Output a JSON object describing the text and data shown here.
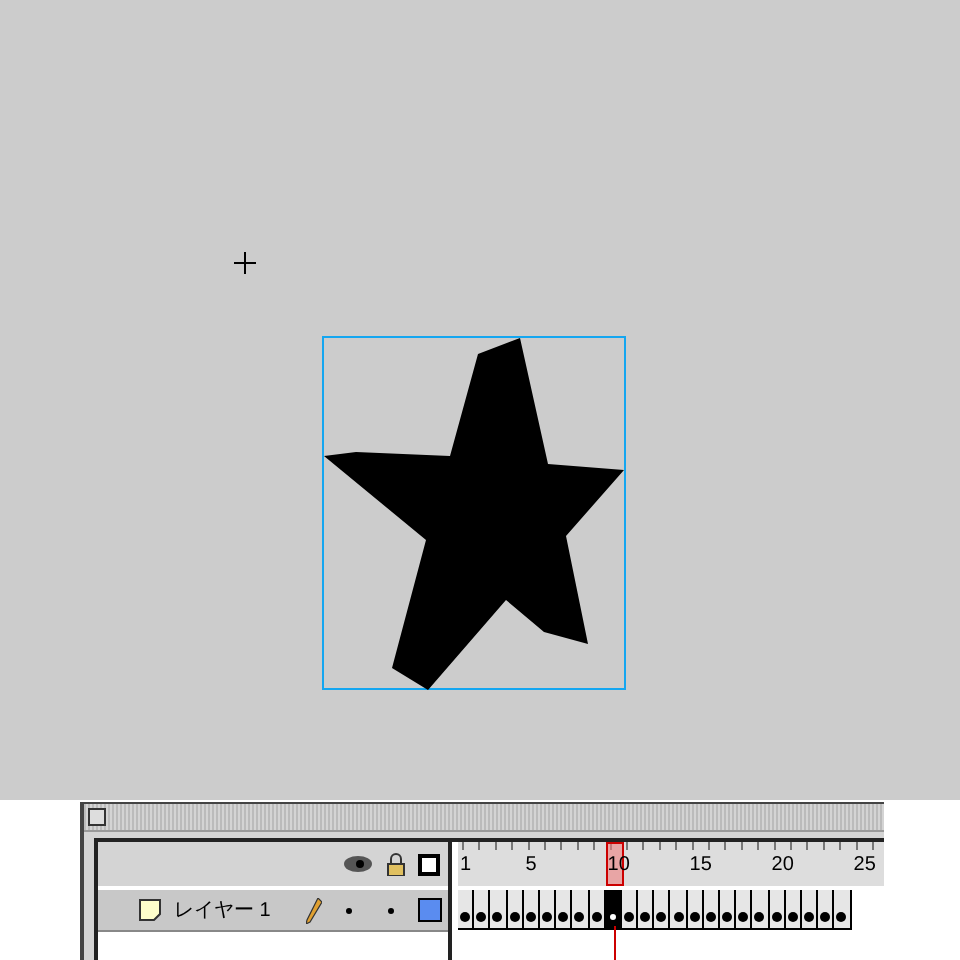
{
  "timeline": {
    "ruler": [
      {
        "label": "1"
      },
      {
        "label": "5"
      },
      {
        "label": "10"
      },
      {
        "label": "15"
      },
      {
        "label": "20"
      },
      {
        "label": "25"
      }
    ],
    "layers": [
      {
        "name": "レイヤー 1",
        "selected": true,
        "color": "#5a8cf0",
        "frames": [
          {
            "kind": "keyframe",
            "selected": false
          },
          {
            "kind": "keyframe",
            "selected": false
          },
          {
            "kind": "keyframe",
            "selected": false
          },
          {
            "kind": "keyframe",
            "selected": false
          },
          {
            "kind": "keyframe",
            "selected": false
          },
          {
            "kind": "keyframe",
            "selected": false
          },
          {
            "kind": "keyframe",
            "selected": false
          },
          {
            "kind": "keyframe",
            "selected": false
          },
          {
            "kind": "keyframe",
            "selected": false
          },
          {
            "kind": "keyframe",
            "selected": true
          },
          {
            "kind": "keyframe",
            "selected": false
          },
          {
            "kind": "keyframe",
            "selected": false
          },
          {
            "kind": "keyframe",
            "selected": false
          },
          {
            "kind": "keyframe",
            "selected": false
          },
          {
            "kind": "keyframe",
            "selected": false
          },
          {
            "kind": "keyframe",
            "selected": false
          },
          {
            "kind": "keyframe",
            "selected": false
          },
          {
            "kind": "keyframe",
            "selected": false
          },
          {
            "kind": "keyframe",
            "selected": false
          },
          {
            "kind": "keyframe",
            "selected": false
          },
          {
            "kind": "keyframe",
            "selected": false
          },
          {
            "kind": "keyframe",
            "selected": false
          },
          {
            "kind": "keyframe",
            "selected": false
          },
          {
            "kind": "keyframe",
            "selected": false
          }
        ]
      }
    ]
  }
}
